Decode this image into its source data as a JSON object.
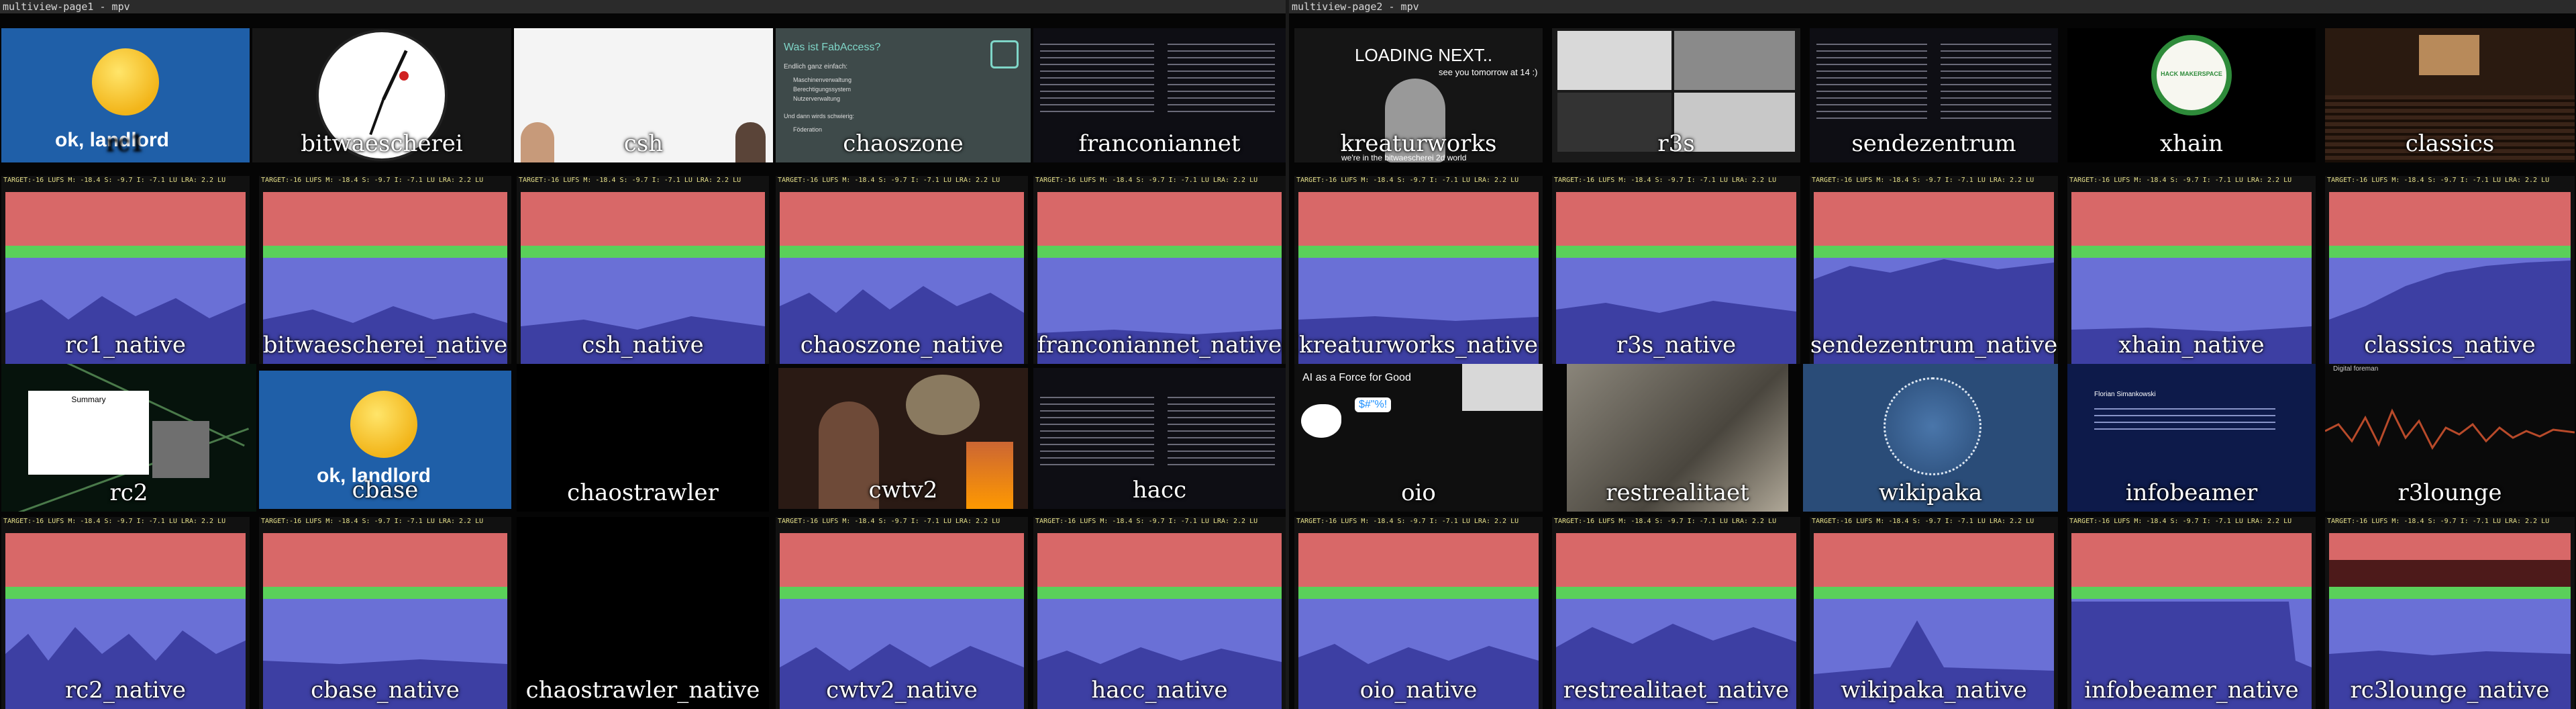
{
  "windows": [
    {
      "title": "multiview-page1 - mpv"
    },
    {
      "title": "multiview-page2 - mpv"
    }
  ],
  "stats_text": "TARGET:-16 LUFS   M: -18.4 S: -9.7  I: -7.1 LU    LRA:  2.2 LU",
  "page1": {
    "video_labels": [
      "rc1",
      "bitwaescherei",
      "csh",
      "chaoszone",
      "franconiannet",
      "rc2",
      "cbase",
      "chaostrawler",
      "cwtv2",
      "hacc"
    ],
    "native_labels": [
      "rc1_native",
      "bitwaescherei_native",
      "csh_native",
      "chaoszone_native",
      "franconiannet_native",
      "rc2_native",
      "cbase_native",
      "chaostrawler_native",
      "cwtv2_native",
      "hacc_native"
    ]
  },
  "page2": {
    "video_labels": [
      "kreaturworks",
      "r3s",
      "sendezentrum",
      "xhain",
      "classics",
      "oio",
      "restrealitaet",
      "wikipaka",
      "infobeamer",
      "r3lounge"
    ],
    "native_labels": [
      "kreaturworks_native",
      "r3s_native",
      "sendezentrum_native",
      "xhain_native",
      "classics_native",
      "oio_native",
      "restrealitaet_native",
      "wikipaka_native",
      "infobeamer_native",
      "rc3lounge_native"
    ]
  },
  "content": {
    "ok_landlord": "ok, landlord",
    "fab_title": "Was ist FabAccess?",
    "fab_sub": "Endlich ganz einfach:",
    "fab_items": [
      "Maschinenverwaltung",
      "Berechtigungssystem",
      "Nutzerverwaltung"
    ],
    "fab_more": "Und dann wirds schwierig:",
    "fab_more_item": "Föderation",
    "loading_next": "LOADING NEXT..",
    "see_you": "see you tomorrow at 14 :)",
    "bitwaescherei_world": "we're in the bitwaescherei 2d world",
    "summary_title": "Summary",
    "ai_force": "AI as a Force for Good",
    "oio_tag": "$#\"%!",
    "hack_maker": "HACK MAKERSPACE",
    "xhain_ring": "XHAIN",
    "digital_foreman": "Digital foreman",
    "florian": "Florian Simankowski"
  },
  "colors": {
    "meter_red": "#d86868",
    "meter_green": "#5ad05a",
    "meter_blue_top": "#6a70d6",
    "meter_blue": "#3d3fa3",
    "stats_text": "#e6e08a"
  }
}
